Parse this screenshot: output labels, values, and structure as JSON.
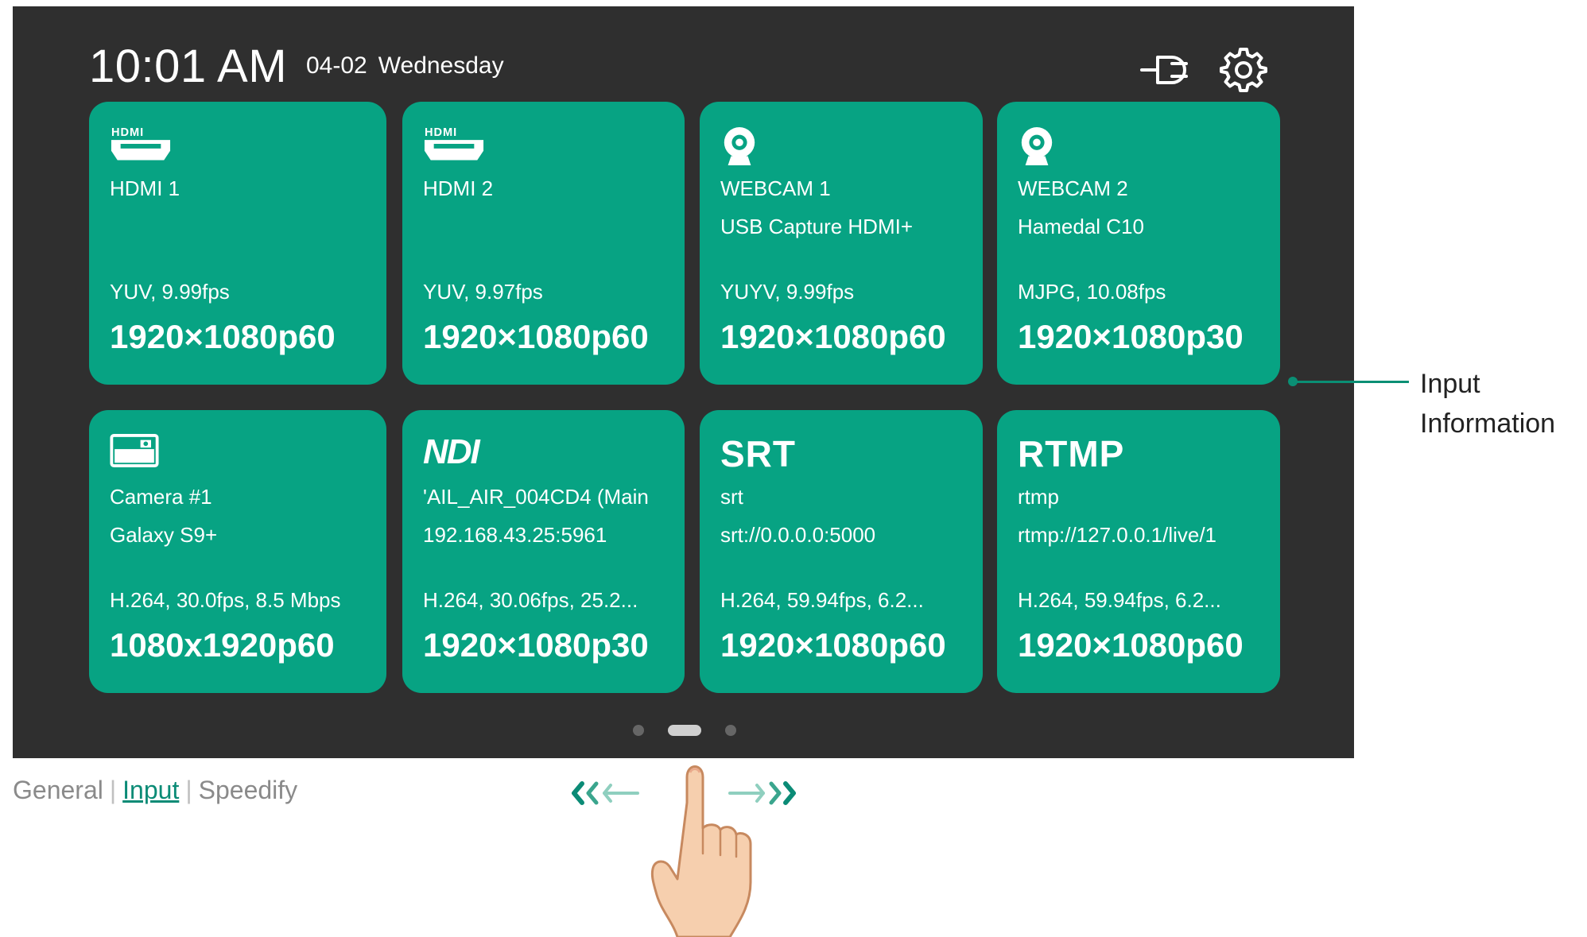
{
  "status_bar": {
    "time": "10:01 AM",
    "date": "04-02",
    "weekday": "Wednesday",
    "icons": [
      "power-plug-icon",
      "gear-icon"
    ]
  },
  "inputs": [
    {
      "icon": "hdmi-icon",
      "name": "HDMI 1",
      "device": "",
      "format": "YUV, 9.99fps",
      "resolution": "1920×1080p60"
    },
    {
      "icon": "hdmi-icon",
      "name": "HDMI 2",
      "device": "",
      "format": "YUV, 9.97fps",
      "resolution": "1920×1080p60"
    },
    {
      "icon": "webcam-icon",
      "name": "WEBCAM 1",
      "device": "USB Capture HDMI+",
      "format": "YUYV, 9.99fps",
      "resolution": "1920×1080p60"
    },
    {
      "icon": "webcam-icon",
      "name": "WEBCAM 2",
      "device": "Hamedal C10",
      "format": "MJPG, 10.08fps",
      "resolution": "1920×1080p30"
    },
    {
      "icon": "camera-app-icon",
      "name": "Camera #1",
      "device": "Galaxy S9+",
      "format": "H.264, 30.0fps, 8.5 Mbps",
      "resolution": "1080x1920p60"
    },
    {
      "icon_text": "NDI",
      "name": "'AIL_AIR_004CD4 (Main",
      "device": "192.168.43.25:5961",
      "format": "H.264, 30.06fps, 25.2...",
      "resolution": "1920×1080p30"
    },
    {
      "icon_text": "SRT",
      "name": "srt",
      "device": "srt://0.0.0.0:5000",
      "format": "H.264, 59.94fps, 6.2...",
      "resolution": "1920×1080p60"
    },
    {
      "icon_text": "RTMP",
      "name": "rtmp",
      "device": "rtmp://127.0.0.1/live/1",
      "format": "H.264, 59.94fps, 6.2...",
      "resolution": "1920×1080p60"
    }
  ],
  "pagination": {
    "pages": 3,
    "current": 2
  },
  "annotation": {
    "line1": "Input",
    "line2": "Information"
  },
  "breadcrumb": {
    "general": "General",
    "input": "Input",
    "speedify": "Speedify",
    "separator": "|"
  },
  "colors": {
    "screen_bg": "#2f2f2f",
    "card_bg": "#07a383",
    "accent": "#0b8b76"
  }
}
